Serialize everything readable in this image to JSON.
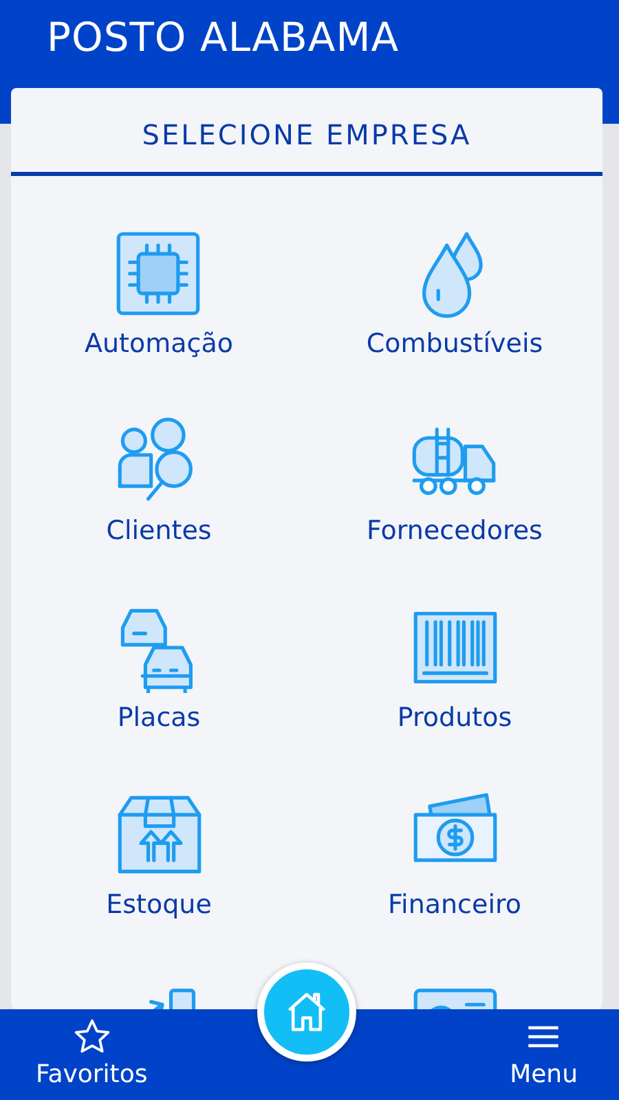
{
  "header": {
    "title": "POSTO ALABAMA"
  },
  "panel": {
    "title": "SELECIONE EMPRESA"
  },
  "items": [
    {
      "kind": "tile",
      "label": "Automação"
    },
    {
      "kind": "tile",
      "label": "Combustíveis"
    },
    {
      "kind": "tile",
      "label": "Clientes"
    },
    {
      "kind": "tile",
      "label": "Fornecedores"
    },
    {
      "kind": "tile",
      "label": "Placas"
    },
    {
      "kind": "tile",
      "label": "Produtos"
    },
    {
      "kind": "tile",
      "label": "Estoque"
    },
    {
      "kind": "tile",
      "label": "Financeiro"
    },
    {
      "kind": "cut_off"
    },
    {
      "kind": "cut_off"
    }
  ],
  "bottom_nav": [
    {
      "label": "Favoritos",
      "kind": "favorites"
    },
    {
      "kind": "home"
    },
    {
      "label": "Menu",
      "kind": "menu"
    }
  ]
}
